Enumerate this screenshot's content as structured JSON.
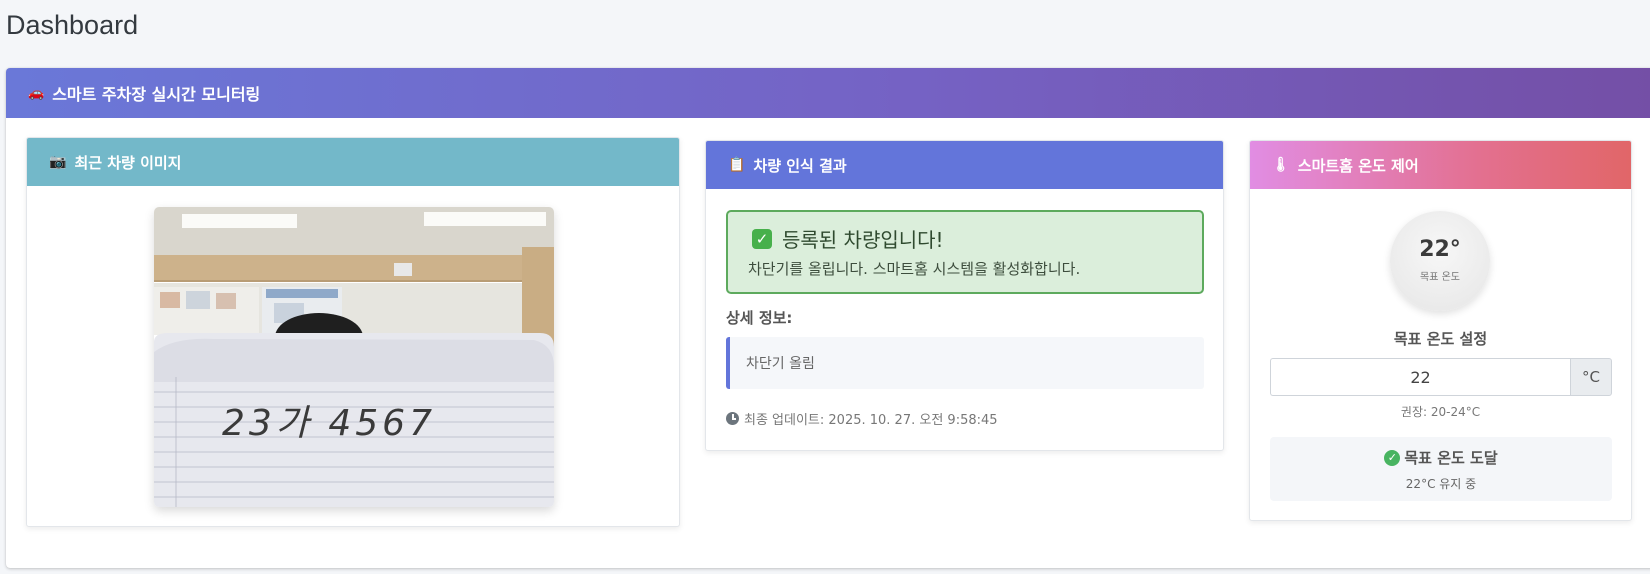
{
  "page": {
    "title": "Dashboard"
  },
  "main": {
    "header": "스마트 주차장 실시간 모니터링",
    "icon": "car-icon"
  },
  "image_card": {
    "header": "최근 차량 이미지",
    "icon": "camera-icon",
    "photo_plate_text": "23가 4567"
  },
  "result_card": {
    "header": "차량 인식 결과",
    "icon": "clipboard-icon",
    "alert_title": "등록된 차량입니다!",
    "alert_text": "차단기를 올립니다. 스마트홈 시스템을 활성화합니다.",
    "detail_label": "상세 정보:",
    "detail_text": "차단기 올림",
    "updated": "최종 업데이트: 2025. 10. 27. 오전 9:58:45"
  },
  "temp_card": {
    "header": "스마트홈 온도 제어",
    "icon": "thermometer-icon",
    "dial_value": "22°",
    "dial_label": "목표 온도",
    "set_label": "목표 온도 설정",
    "input_value": "22",
    "unit": "°C",
    "hint": "권장: 20-24°C",
    "status_title": "목표 온도 도달",
    "status_sub": "22°C 유지 중"
  },
  "colors": {
    "image_header": "#73b8c9",
    "result_header": "#6375da",
    "alert_bg": "#dbeedb",
    "alert_border": "#5daa5d"
  }
}
